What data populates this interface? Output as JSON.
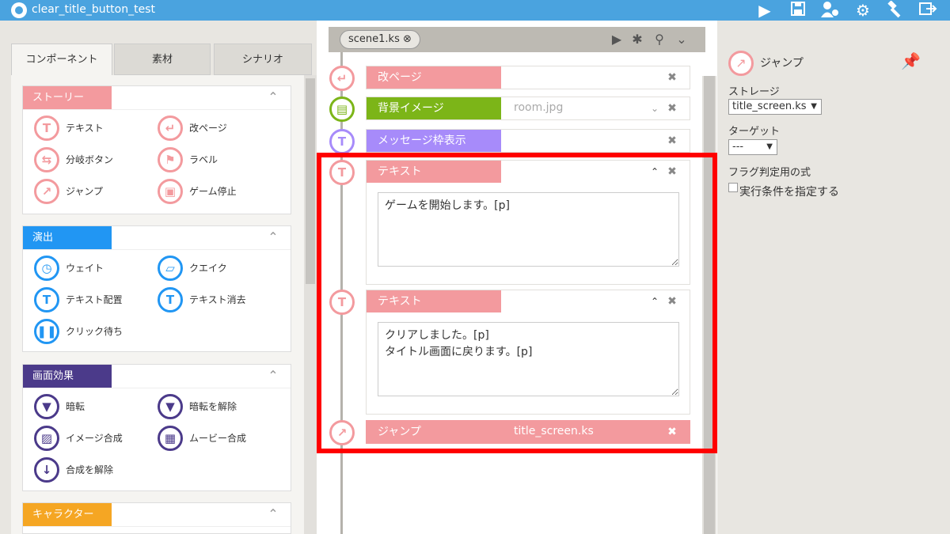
{
  "app": {
    "title": "clear_title_button_test"
  },
  "left": {
    "tabs": [
      {
        "label": "コンポーネント"
      },
      {
        "label": "素材"
      },
      {
        "label": "シナリオ"
      }
    ],
    "categories": [
      {
        "label": "ストーリー",
        "color": "#f39a9e",
        "items": [
          "テキスト",
          "改ページ",
          "分岐ボタン",
          "ラベル",
          "ジャンプ",
          "ゲーム停止"
        ]
      },
      {
        "label": "演出",
        "color": "#2196f3",
        "items": [
          "ウェイト",
          "クエイク",
          "テキスト配置",
          "テキスト消去",
          "クリック待ち"
        ]
      },
      {
        "label": "画面効果",
        "color": "#4b3a8a",
        "items": [
          "暗転",
          "暗転を解除",
          "イメージ合成",
          "ムービー合成",
          "合成を解除"
        ]
      },
      {
        "label": "キャラクター",
        "color": "#f5a623",
        "items": []
      }
    ]
  },
  "center": {
    "scene_tab": "scene1.ks",
    "rows": [
      {
        "label": "改ページ",
        "color": "#f39a9e",
        "value": ""
      },
      {
        "label": "背景イメージ",
        "color": "#7cb518",
        "value": "room.jpg"
      },
      {
        "label": "メッセージ枠表示",
        "color": "#a78bfa",
        "value": ""
      },
      {
        "label": "テキスト",
        "color": "#f39a9e",
        "text": "ゲームを開始します。[p]"
      },
      {
        "label": "テキスト",
        "color": "#f39a9e",
        "text": "クリアしました。[p]\nタイトル画面に戻ります。[p]"
      },
      {
        "label": "ジャンプ",
        "color": "#f39a9e",
        "value": "title_screen.ks"
      }
    ]
  },
  "right": {
    "title": "ジャンプ",
    "storage_label": "ストレージ",
    "storage_value": "title_screen.ks",
    "target_label": "ターゲット",
    "target_value": "---",
    "flag_label": "フラグ判定用の式",
    "condition_label": "実行条件を指定する"
  },
  "colors": {
    "accent": "#4aa3df",
    "highlight": "#ff0000"
  }
}
